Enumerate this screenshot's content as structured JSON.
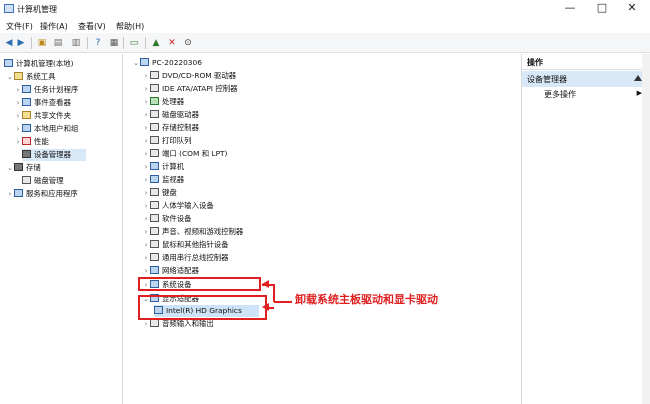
{
  "window": {
    "title": "计算机管理",
    "controls": {
      "minimize": "—",
      "maximize": "□",
      "close": "✕"
    }
  },
  "menu": [
    "文件(F)",
    "操作(A)",
    "查看(V)",
    "帮助(H)"
  ],
  "toolbar": {
    "icons": [
      "back-arrow-icon",
      "forward-arrow-icon",
      "up-folder-icon",
      "show-hide-tree-icon",
      "properties-icon",
      "help-icon",
      "view-icon",
      "scan-hardware-icon",
      "delete-icon",
      "download-icon"
    ]
  },
  "left_tree": [
    {
      "label": "计算机管理(本地)",
      "level": 0,
      "expanded": true
    },
    {
      "label": "系统工具",
      "level": 1,
      "expanded": true
    },
    {
      "label": "任务计划程序",
      "level": 2
    },
    {
      "label": "事件查看器",
      "level": 2
    },
    {
      "label": "共享文件夹",
      "level": 2
    },
    {
      "label": "本地用户和组",
      "level": 2
    },
    {
      "label": "性能",
      "level": 2
    },
    {
      "label": "设备管理器",
      "level": 2,
      "selected": true
    },
    {
      "label": "存储",
      "level": 1,
      "expanded": true
    },
    {
      "label": "磁盘管理",
      "level": 2
    },
    {
      "label": "服务和应用程序",
      "level": 1
    }
  ],
  "device_tree": {
    "root": "PC-20220306",
    "items": [
      "DVD/CD-ROM 驱动器",
      "IDE ATA/ATAPI 控制器",
      "处理器",
      "磁盘驱动器",
      "存储控制器",
      "打印队列",
      "端口 (COM 和 LPT)",
      "计算机",
      "监视器",
      "键盘",
      "人体学输入设备",
      "软件设备",
      "声音、视频和游戏控制器",
      "鼠标和其他指针设备",
      "通用串行总线控制器",
      "网络适配器",
      "系统设备",
      "显示适配器",
      "Intel(R) HD Graphics",
      "音频输入和输出"
    ]
  },
  "actions": {
    "header": "操作",
    "section": "设备管理器",
    "item": "更多操作"
  },
  "annotation": "卸载系统主板驱动和显卡驱动"
}
